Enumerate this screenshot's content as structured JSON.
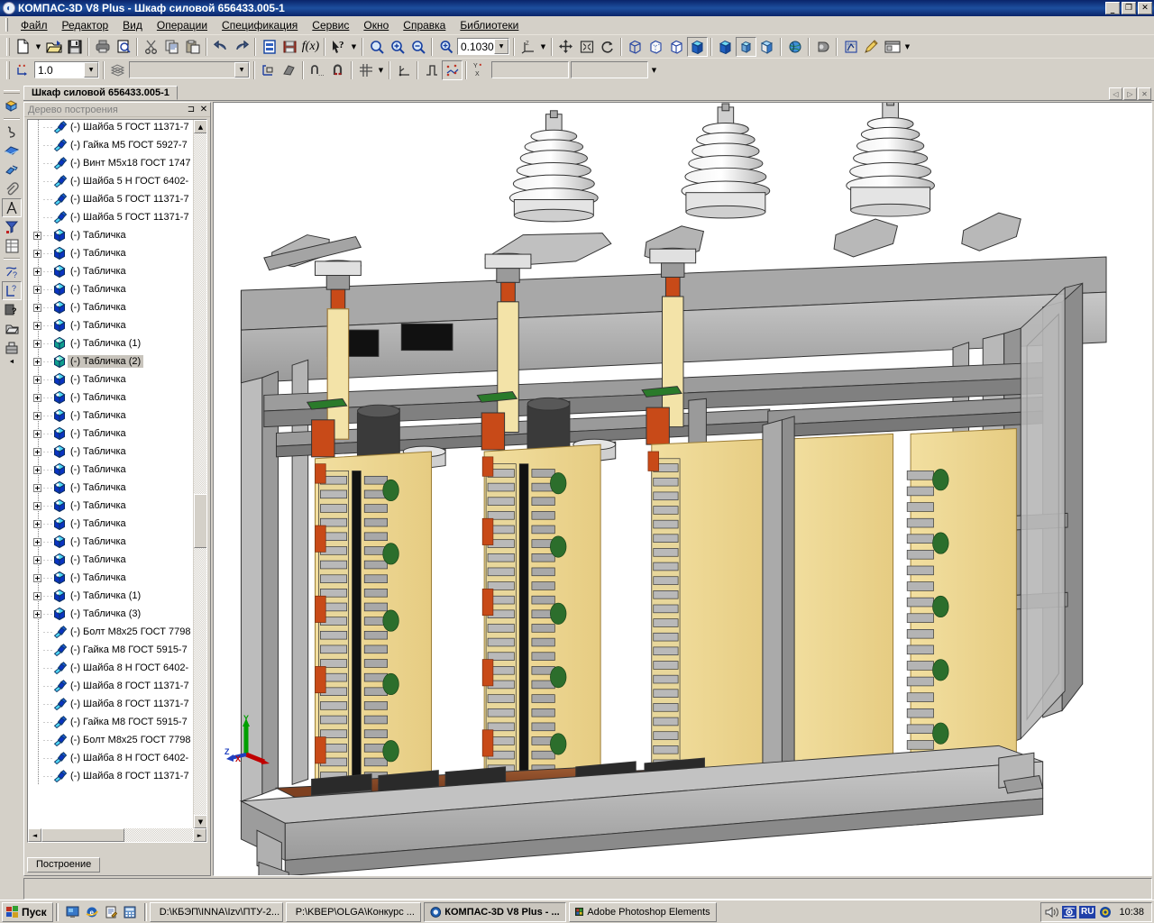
{
  "window": {
    "title": "КОМПАС-3D V8 Plus - Шкаф силовой 656433.005-1",
    "icon": "kompas-logo-icon",
    "minimize": "_",
    "maximize": "❐",
    "close": "✕"
  },
  "menu": [
    {
      "label": "Файл"
    },
    {
      "label": "Редактор"
    },
    {
      "label": "Вид"
    },
    {
      "label": "Операции"
    },
    {
      "label": "Спецификация"
    },
    {
      "label": "Сервис"
    },
    {
      "label": "Окно"
    },
    {
      "label": "Справка"
    },
    {
      "label": "Библиотеки"
    }
  ],
  "toolbar_standard": {
    "zoom_value": "0.1030",
    "buttons": [
      {
        "name": "new-document-button",
        "icon": "new-doc-icon"
      },
      {
        "name": "new-document-dropdown",
        "icon": "chevron-down-icon"
      },
      {
        "name": "open-document-button",
        "icon": "open-folder-icon"
      },
      {
        "name": "save-document-button",
        "icon": "floppy-disk-icon"
      },
      {
        "name": "print-button",
        "icon": "printer-icon"
      },
      {
        "name": "print-preview-button",
        "icon": "print-preview-icon"
      },
      {
        "name": "cut-button",
        "icon": "scissors-icon"
      },
      {
        "name": "copy-button",
        "icon": "copy-icon"
      },
      {
        "name": "paste-button",
        "icon": "paste-icon"
      },
      {
        "name": "undo-button",
        "icon": "undo-arrow-icon"
      },
      {
        "name": "redo-button",
        "icon": "redo-arrow-icon"
      },
      {
        "name": "properties-button",
        "icon": "properties-icon"
      },
      {
        "name": "specification-button",
        "icon": "specification-icon"
      },
      {
        "name": "variables-button",
        "icon": "fx-icon"
      },
      {
        "name": "context-help-button",
        "icon": "arrow-question-icon"
      },
      {
        "name": "context-help-dropdown",
        "icon": "chevron-down-icon"
      },
      {
        "name": "zoom-window-button",
        "icon": "magnifier-icon"
      },
      {
        "name": "zoom-in-button",
        "icon": "magnifier-plus-icon"
      },
      {
        "name": "zoom-out-button",
        "icon": "magnifier-minus-icon"
      },
      {
        "name": "zoom-scale-button",
        "icon": "magnifier-scale-icon"
      },
      {
        "name": "orientation-button",
        "icon": "axes-icon"
      },
      {
        "name": "orientation-dropdown",
        "icon": "chevron-down-icon"
      },
      {
        "name": "pan-button",
        "icon": "four-arrows-icon"
      },
      {
        "name": "fit-to-screen-button",
        "icon": "fit-screen-icon"
      },
      {
        "name": "rotate-button",
        "icon": "rotate-icon"
      },
      {
        "name": "wireframe-button",
        "icon": "wireframe-cube-icon"
      },
      {
        "name": "hidden-lines-thin-button",
        "icon": "hidden-lines-cube-icon"
      },
      {
        "name": "no-hidden-lines-button",
        "icon": "no-hidden-lines-cube-icon"
      },
      {
        "name": "shaded-with-edges-button",
        "icon": "shaded-edges-cube-icon"
      },
      {
        "name": "shaded-button",
        "icon": "shaded-cube-icon"
      },
      {
        "name": "perspective-button",
        "icon": "perspective-cube-icon"
      },
      {
        "name": "section-button",
        "icon": "section-cube-icon"
      },
      {
        "name": "globe-button",
        "icon": "globe-icon"
      },
      {
        "name": "light-source-button",
        "icon": "light-source-icon"
      },
      {
        "name": "sketch-button",
        "icon": "sketch-icon"
      },
      {
        "name": "edit-color-button",
        "icon": "paint-pen-icon"
      },
      {
        "name": "layers-button",
        "icon": "window-layers-icon"
      },
      {
        "name": "layers-dropdown",
        "icon": "chevron-down-icon"
      }
    ]
  },
  "toolbar_current_state": {
    "scale_value": "1.0",
    "layer_value": "",
    "style_value": "",
    "extra_value": "",
    "buttons": [
      {
        "name": "current-step-button",
        "icon": "step-points-icon"
      },
      {
        "name": "layers-list-button",
        "icon": "layers-stack-icon"
      },
      {
        "name": "local-coord-button",
        "icon": "local-coordinate-icon"
      },
      {
        "name": "view-state-button",
        "icon": "view-state-icon"
      },
      {
        "name": "snap-help-button",
        "icon": "snap-question-icon"
      },
      {
        "name": "snap-magnet-button",
        "icon": "snap-magnet-icon"
      },
      {
        "name": "grid-button",
        "icon": "grid-icon"
      },
      {
        "name": "grid-dropdown",
        "icon": "chevron-down-icon"
      },
      {
        "name": "local-cs-button",
        "icon": "local-cs-axes-icon"
      },
      {
        "name": "step-curve-button",
        "icon": "step-curve-icon"
      },
      {
        "name": "snaps-button",
        "icon": "snaps-points-icon"
      },
      {
        "name": "restricted-snaps-button",
        "icon": "restricted-snaps-icon"
      },
      {
        "name": "extra-dropdown",
        "icon": "chevron-down-icon"
      }
    ]
  },
  "vertical_toolbar": [
    {
      "name": "compact-panel-button",
      "icon": "compact-panel-icon"
    },
    {
      "name": "spline-button",
      "icon": "spline-curve-icon"
    },
    {
      "name": "surface-button",
      "icon": "surface-icon"
    },
    {
      "name": "array-button",
      "icon": "array-icon"
    },
    {
      "name": "measure-button",
      "icon": "paperclip-icon"
    },
    {
      "name": "measure-compass-button",
      "icon": "compass-measure-icon"
    },
    {
      "name": "filter-button",
      "icon": "filter-icon"
    },
    {
      "name": "specification-object-button",
      "icon": "spec-table-icon"
    },
    {
      "name": "help-pointer-button",
      "icon": "help-pointer-icon"
    },
    {
      "name": "help-dimension-button",
      "icon": "help-dimension-icon"
    },
    {
      "name": "help-shading-button",
      "icon": "help-shading-icon"
    },
    {
      "name": "component-button",
      "icon": "component-icon"
    },
    {
      "name": "assembly-button",
      "icon": "assembly-icon"
    }
  ],
  "document": {
    "tab_label": "Шкаф силовой 656433.005-1",
    "mdi_buttons": [
      {
        "name": "mdi-prev-button",
        "icon": "triangle-left-icon"
      },
      {
        "name": "mdi-next-button",
        "icon": "triangle-right-icon"
      },
      {
        "name": "mdi-close-button",
        "icon": "close-icon"
      }
    ]
  },
  "tree_panel": {
    "caption": "Дерево построения",
    "pin_icon": "pin-icon",
    "close_icon": "close-icon",
    "tab_label": "Построение",
    "items": [
      {
        "label": "(-) Шайба 5 ГОСТ 11371-7",
        "icon": "bolt-icon",
        "expandable": false,
        "selected": false,
        "tint": "blue"
      },
      {
        "label": "(-) Гайка М5 ГОСТ 5927-7",
        "icon": "bolt-icon",
        "expandable": false,
        "selected": false,
        "tint": "blue"
      },
      {
        "label": "(-) Винт М5x18 ГОСТ 1747",
        "icon": "bolt-icon",
        "expandable": false,
        "selected": false,
        "tint": "blue"
      },
      {
        "label": "(-) Шайба 5 Н ГОСТ 6402-",
        "icon": "bolt-icon",
        "expandable": false,
        "selected": false,
        "tint": "blue"
      },
      {
        "label": "(-) Шайба 5 ГОСТ 11371-7",
        "icon": "bolt-icon",
        "expandable": false,
        "selected": false,
        "tint": "blue"
      },
      {
        "label": "(-) Шайба 5 ГОСТ 11371-7",
        "icon": "bolt-icon",
        "expandable": false,
        "selected": false,
        "tint": "blue"
      },
      {
        "label": "(-) Табличка",
        "icon": "part-icon",
        "expandable": true,
        "selected": false,
        "tint": "blue"
      },
      {
        "label": "(-) Табличка",
        "icon": "part-icon",
        "expandable": true,
        "selected": false,
        "tint": "blue"
      },
      {
        "label": "(-) Табличка",
        "icon": "part-icon",
        "expandable": true,
        "selected": false,
        "tint": "blue"
      },
      {
        "label": "(-) Табличка",
        "icon": "part-icon",
        "expandable": true,
        "selected": false,
        "tint": "blue"
      },
      {
        "label": "(-) Табличка",
        "icon": "part-icon",
        "expandable": true,
        "selected": false,
        "tint": "blue"
      },
      {
        "label": "(-) Табличка",
        "icon": "part-icon",
        "expandable": true,
        "selected": false,
        "tint": "blue"
      },
      {
        "label": "(-) Табличка (1)",
        "icon": "part-icon",
        "expandable": true,
        "selected": false,
        "tint": "teal"
      },
      {
        "label": "(-) Табличка (2)",
        "icon": "part-icon",
        "expandable": true,
        "selected": true,
        "tint": "teal"
      },
      {
        "label": "(-) Табличка",
        "icon": "part-icon",
        "expandable": true,
        "selected": false,
        "tint": "blue"
      },
      {
        "label": "(-) Табличка",
        "icon": "part-icon",
        "expandable": true,
        "selected": false,
        "tint": "blue"
      },
      {
        "label": "(-) Табличка",
        "icon": "part-icon",
        "expandable": true,
        "selected": false,
        "tint": "blue"
      },
      {
        "label": "(-) Табличка",
        "icon": "part-icon",
        "expandable": true,
        "selected": false,
        "tint": "blue"
      },
      {
        "label": "(-) Табличка",
        "icon": "part-icon",
        "expandable": true,
        "selected": false,
        "tint": "blue"
      },
      {
        "label": "(-) Табличка",
        "icon": "part-icon",
        "expandable": true,
        "selected": false,
        "tint": "blue"
      },
      {
        "label": "(-) Табличка",
        "icon": "part-icon",
        "expandable": true,
        "selected": false,
        "tint": "blue"
      },
      {
        "label": "(-) Табличка",
        "icon": "part-icon",
        "expandable": true,
        "selected": false,
        "tint": "blue"
      },
      {
        "label": "(-) Табличка",
        "icon": "part-icon",
        "expandable": true,
        "selected": false,
        "tint": "blue"
      },
      {
        "label": "(-) Табличка",
        "icon": "part-icon",
        "expandable": true,
        "selected": false,
        "tint": "blue"
      },
      {
        "label": "(-) Табличка",
        "icon": "part-icon",
        "expandable": true,
        "selected": false,
        "tint": "blue"
      },
      {
        "label": "(-) Табличка",
        "icon": "part-icon",
        "expandable": true,
        "selected": false,
        "tint": "blue"
      },
      {
        "label": "(-) Табличка (1)",
        "icon": "part-icon",
        "expandable": true,
        "selected": false,
        "tint": "blue"
      },
      {
        "label": "(-) Табличка (3)",
        "icon": "part-icon",
        "expandable": true,
        "selected": false,
        "tint": "blue"
      },
      {
        "label": "(-) Болт М8x25 ГОСТ 7798",
        "icon": "bolt-icon",
        "expandable": false,
        "selected": false,
        "tint": "blue"
      },
      {
        "label": "(-) Гайка М8 ГОСТ 5915-7",
        "icon": "bolt-icon",
        "expandable": false,
        "selected": false,
        "tint": "blue"
      },
      {
        "label": "(-) Шайба 8 Н ГОСТ 6402-",
        "icon": "bolt-icon",
        "expandable": false,
        "selected": false,
        "tint": "blue"
      },
      {
        "label": "(-) Шайба 8 ГОСТ 11371-7",
        "icon": "bolt-icon",
        "expandable": false,
        "selected": false,
        "tint": "blue"
      },
      {
        "label": "(-) Шайба 8 ГОСТ 11371-7",
        "icon": "bolt-icon",
        "expandable": false,
        "selected": false,
        "tint": "blue"
      },
      {
        "label": "(-) Гайка М8 ГОСТ 5915-7",
        "icon": "bolt-icon",
        "expandable": false,
        "selected": false,
        "tint": "blue"
      },
      {
        "label": "(-) Болт М8x25 ГОСТ 7798",
        "icon": "bolt-icon",
        "expandable": false,
        "selected": false,
        "tint": "blue"
      },
      {
        "label": "(-) Шайба 8 Н ГОСТ 6402-",
        "icon": "bolt-icon",
        "expandable": false,
        "selected": false,
        "tint": "blue"
      },
      {
        "label": "(-) Шайба 8 ГОСТ 11371-7",
        "icon": "bolt-icon",
        "expandable": false,
        "selected": false,
        "tint": "blue"
      }
    ]
  },
  "viewport": {
    "model_name": "Шкаф силовой 656433.005-1",
    "axes": {
      "x_label": "X",
      "y_label": "Y",
      "z_label": "Z",
      "x_color": "#cc0000",
      "y_color": "#00aa00",
      "z_color": "#0000cc"
    },
    "background": "#ffffff"
  },
  "taskbar": {
    "start_label": "Пуск",
    "quick_launch": [
      {
        "name": "show-desktop-icon",
        "icon": "desktop-icon"
      },
      {
        "name": "internet-explorer-icon",
        "icon": "ie-icon"
      },
      {
        "name": "notepad-icon",
        "icon": "notepad-icon"
      },
      {
        "name": "calculator-icon",
        "icon": "calculator-icon"
      }
    ],
    "items": [
      {
        "label": "D:\\КБЭП\\INNA\\Izv\\ПТУ-2...",
        "icon": "folder-icon",
        "active": false
      },
      {
        "label": "P:\\KBEP\\OLGA\\Конкурс ...",
        "icon": "folder-icon",
        "active": false
      },
      {
        "label": "КОМПАС-3D V8 Plus - ...",
        "icon": "kompas-logo-icon",
        "active": true
      },
      {
        "label": "Adobe Photoshop Elements",
        "icon": "photoshop-icon",
        "active": false
      }
    ],
    "tray": [
      {
        "name": "volume-icon",
        "icon": "speaker-icon"
      },
      {
        "name": "network-icon",
        "icon": "network-icon"
      },
      {
        "name": "language-indicator",
        "icon": "lang-ru-icon",
        "label": "RU"
      },
      {
        "name": "security-icon",
        "icon": "shield-icon"
      }
    ],
    "clock": "10:38"
  }
}
